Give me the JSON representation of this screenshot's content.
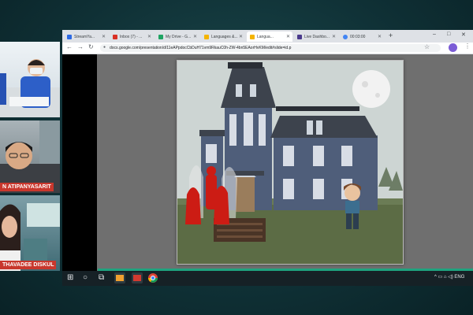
{
  "participants": [
    {
      "name": ""
    },
    {
      "name": "N ATIPANYASARIT"
    },
    {
      "name": "THAVADEE DISKUL"
    }
  ],
  "browser": {
    "tabs": [
      {
        "label": "StreamYa...",
        "icon": "streamyard-icon",
        "color": "#2d6ae3",
        "active": false
      },
      {
        "label": "Inbox (7) - ...",
        "icon": "gmail-icon",
        "color": "#d93025",
        "active": false
      },
      {
        "label": "My Drive - G...",
        "icon": "drive-icon",
        "color": "#1fa463",
        "active": false
      },
      {
        "label": "Languages &...",
        "icon": "slides-icon",
        "color": "#f4b400",
        "active": false
      },
      {
        "label": "Langua...",
        "icon": "slides-icon",
        "color": "#f4b400",
        "active": true
      },
      {
        "label": "Live Dashbo...",
        "icon": "dashboard-icon",
        "color": "#4a3a8c",
        "active": false
      },
      {
        "label": "00:03:00",
        "icon": "google-icon",
        "color": "#4285f4",
        "active": false
      }
    ],
    "url": "docs.google.com/presentation/d/11eAPpdocCbDuH71vm9RkauC0h-ZW-4bn5EAorHvKM/edit#slide=id.p",
    "new_tab": "+",
    "min": "–",
    "max": "□",
    "close": "✕",
    "back": "←",
    "forward": "→",
    "reload": "↻",
    "star": "☆",
    "menu": "⋮"
  },
  "slide": {
    "scene": "haunted-mansion-storyboard",
    "colors": {
      "sky": "#cdd5d3",
      "house": "#4f5e7a",
      "roof": "#3d434d",
      "grass": "#5c6c45",
      "ghost_figure": "#cc1c14",
      "moon": "#f2f2f2"
    }
  },
  "taskbar": {
    "start": "⊞",
    "search": "○",
    "taskview": "⧉",
    "tray": "^ ▭ ⌂ ◁) ENG"
  }
}
